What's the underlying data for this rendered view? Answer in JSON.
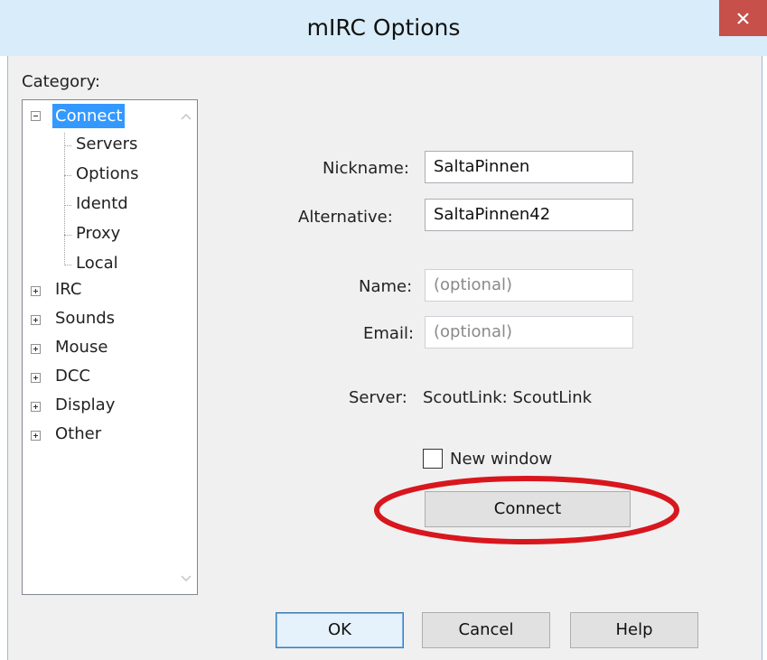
{
  "window": {
    "title": "mIRC Options",
    "close_glyph": "✕"
  },
  "category": {
    "label": "Category:",
    "items": [
      {
        "label": "Connect",
        "expander": "minus",
        "selected": true
      },
      {
        "label": "Servers"
      },
      {
        "label": "Options"
      },
      {
        "label": "Identd"
      },
      {
        "label": "Proxy"
      },
      {
        "label": "Local"
      },
      {
        "label": "IRC",
        "expander": "plus"
      },
      {
        "label": "Sounds",
        "expander": "plus"
      },
      {
        "label": "Mouse",
        "expander": "plus"
      },
      {
        "label": "DCC",
        "expander": "plus"
      },
      {
        "label": "Display",
        "expander": "plus"
      },
      {
        "label": "Other",
        "expander": "plus"
      }
    ]
  },
  "form": {
    "nickname": {
      "label": "Nickname:",
      "value": "SaltaPinnen"
    },
    "alternative": {
      "label": "Alternative:",
      "value": "SaltaPinnen42"
    },
    "name": {
      "label": "Name:",
      "placeholder": "(optional)"
    },
    "email": {
      "label": "Email:",
      "placeholder": "(optional)"
    },
    "server": {
      "label": "Server:",
      "value": "ScoutLink: ScoutLink"
    },
    "new_window": {
      "label": "New window",
      "checked": false
    },
    "connect_label": "Connect"
  },
  "buttons": {
    "ok": "OK",
    "cancel": "Cancel",
    "help": "Help"
  },
  "colors": {
    "selection": "#3399ff",
    "annotation": "#d8161d",
    "close": "#c7504a",
    "titlebar": "#d9ecf9"
  },
  "icons": {
    "close": "close-icon",
    "scroll_up": "chevron-up-icon",
    "scroll_down": "chevron-down-icon",
    "expand": "plus-box-icon",
    "collapse": "minus-box-icon"
  }
}
